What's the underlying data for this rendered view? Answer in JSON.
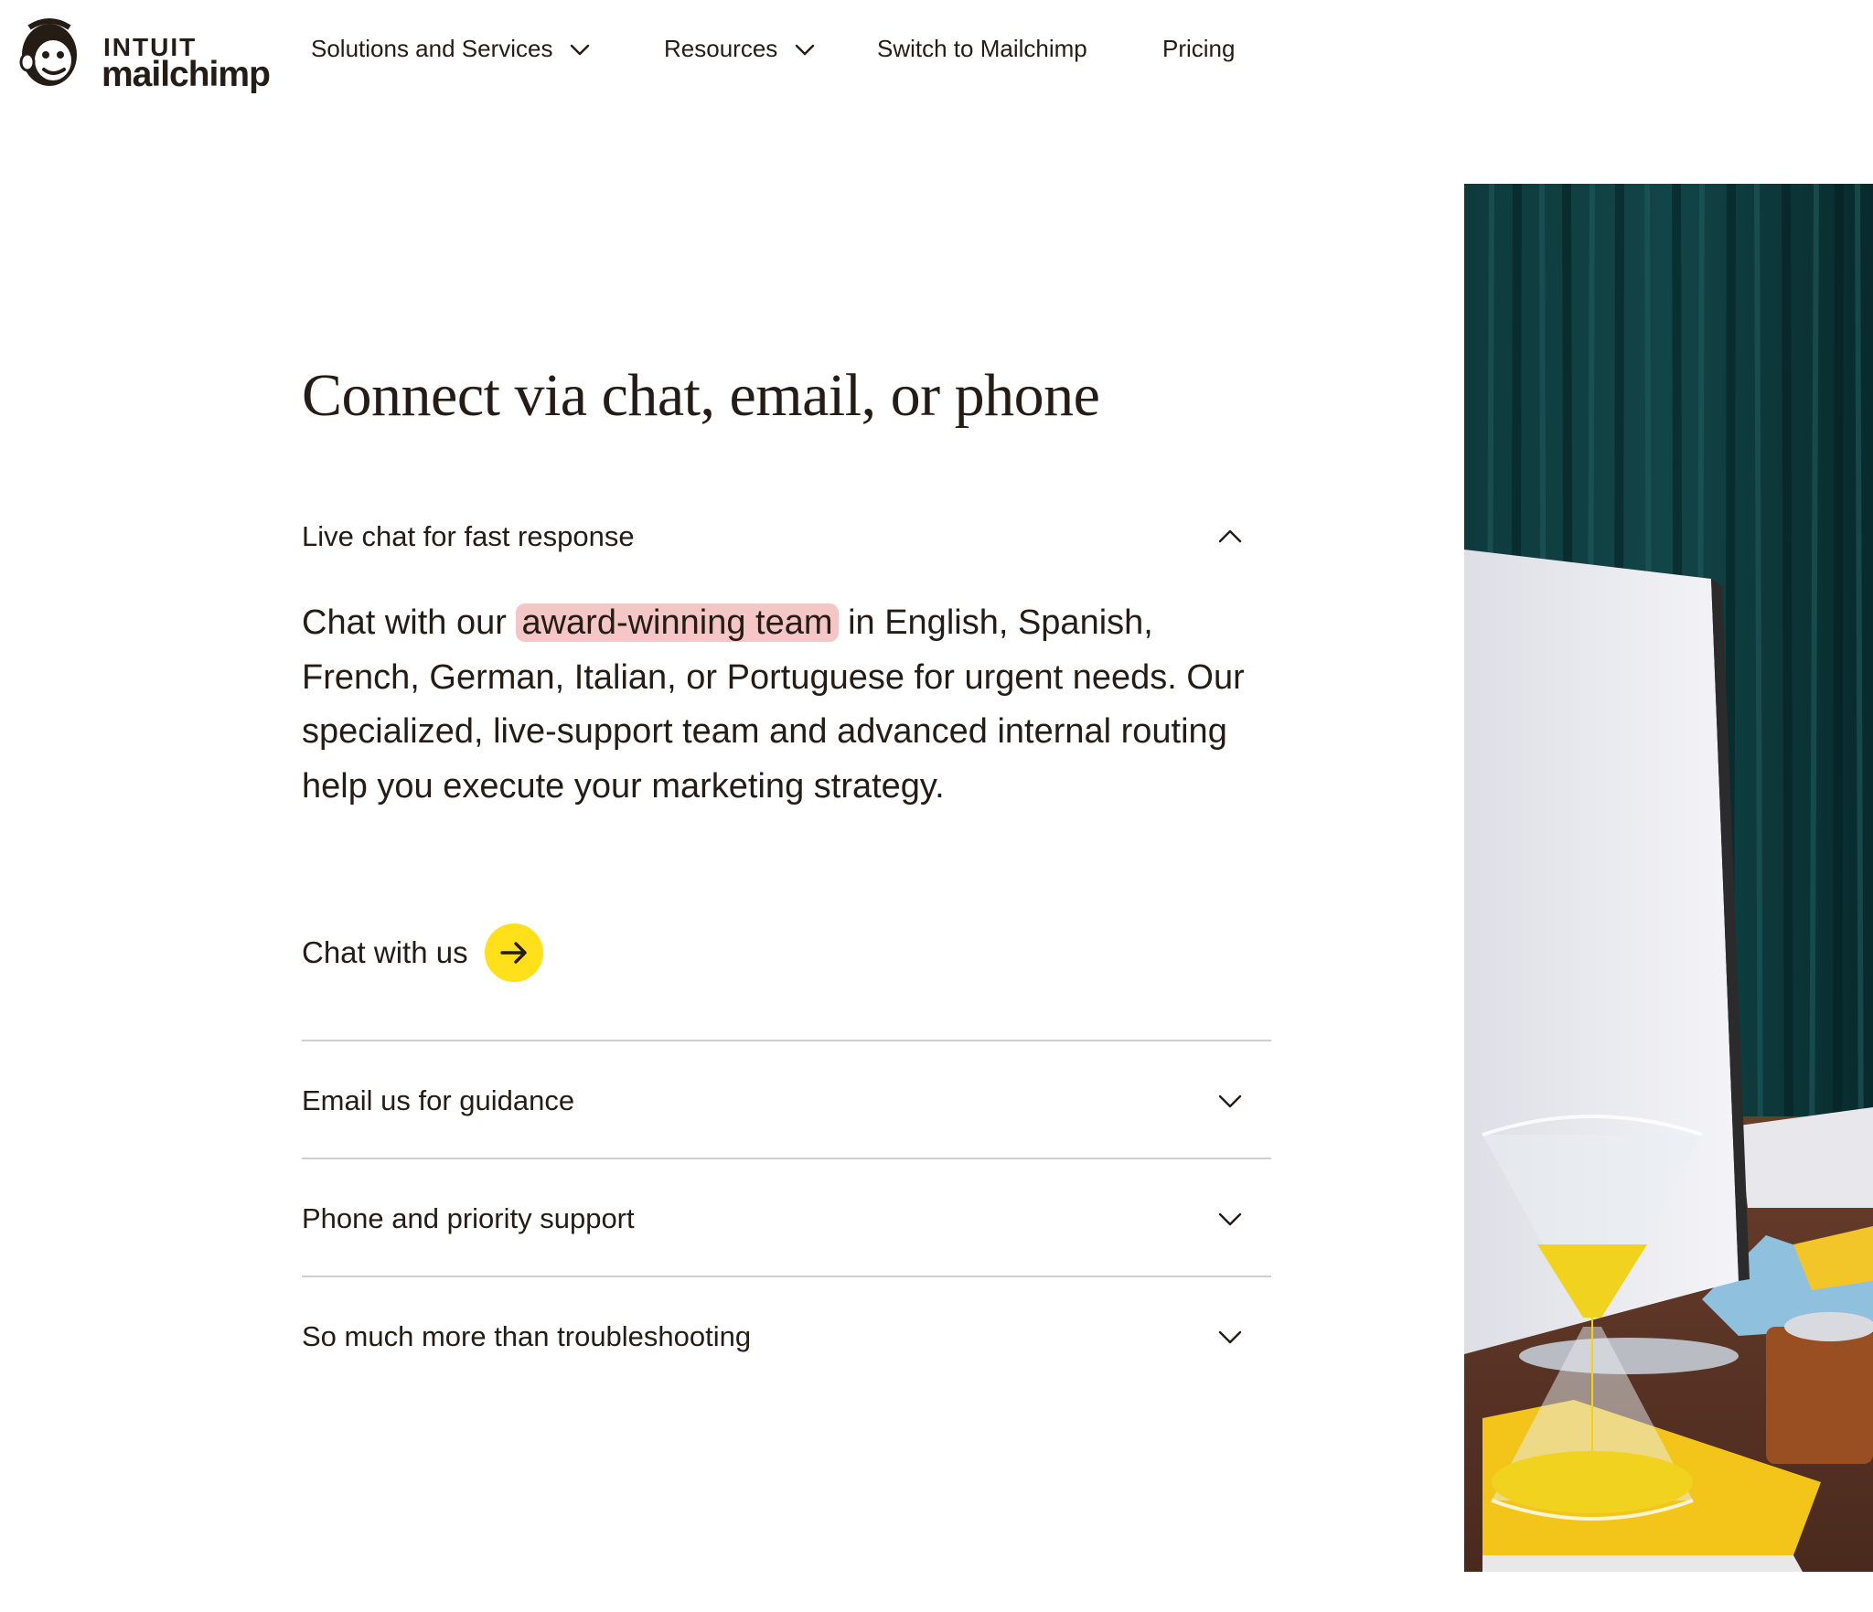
{
  "brand": {
    "line1": "INTUIT",
    "line2": "mailchimp"
  },
  "nav": {
    "items": [
      {
        "label": "Solutions and Services",
        "has_dropdown": true,
        "icon": "chevron-down-icon"
      },
      {
        "label": "Resources",
        "has_dropdown": true,
        "icon": "chevron-down-icon"
      },
      {
        "label": "Switch to Mailchimp",
        "has_dropdown": false
      },
      {
        "label": "Pricing",
        "has_dropdown": false
      }
    ]
  },
  "main": {
    "title": "Connect via chat, email, or phone",
    "accordion": [
      {
        "label": "Live chat for fast response",
        "expanded": true,
        "icon": "chevron-up-icon",
        "body": {
          "before": "Chat with our ",
          "highlight": "award-winning team",
          "after": " in English, Spanish, French, German, Italian, or Portuguese for urgent needs. Our specialized, live-support team and advanced internal routing help you execute your marketing strategy."
        },
        "cta": {
          "label": "Chat with us",
          "icon": "arrow-right-icon"
        }
      },
      {
        "label": "Email us for guidance",
        "expanded": false,
        "icon": "chevron-down-icon"
      },
      {
        "label": "Phone and priority support",
        "expanded": false,
        "icon": "chevron-down-icon"
      },
      {
        "label": "So much more than troubleshooting",
        "expanded": false,
        "icon": "chevron-down-icon"
      }
    ]
  },
  "colors": {
    "text": "#241c15",
    "accent_yellow": "#ffe01b",
    "highlight_pink": "#f4c6c6",
    "divider": "#cfcfcf",
    "curtain_teal": "#0f3b3d"
  }
}
